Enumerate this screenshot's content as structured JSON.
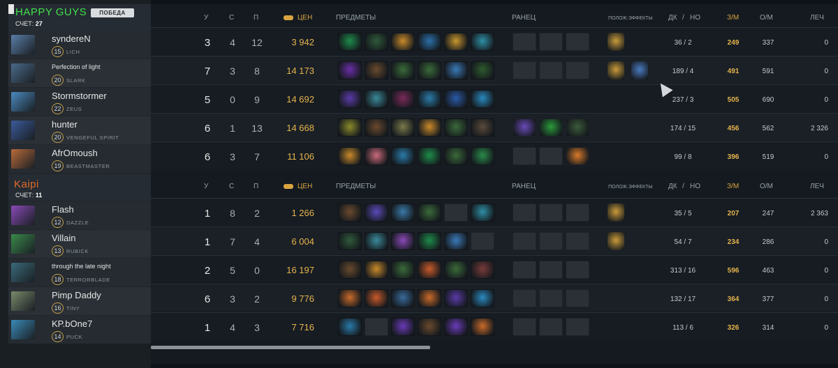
{
  "team1": {
    "name": "HAPPY GUYS",
    "badge": "ПОБЕДА",
    "score_label": "СЧЕТ:",
    "score": "27",
    "name_color": "#3fe04a",
    "players": [
      {
        "name": "syndereN",
        "level": "15",
        "hero": "LICH",
        "portrait": "#5a7fa8",
        "k": "3",
        "d": "4",
        "a": "12",
        "nw": "3 942",
        "items": [
          "#1e8b4a",
          "#2f5a3a",
          "#c98b2a",
          "#2a6fa8",
          "#c9962e",
          "#2e8fa5"
        ],
        "bag": [
          "e",
          "e",
          "e"
        ],
        "buffs": [
          "#c99a3a"
        ],
        "lhd": "36 / 2",
        "gpm": "249",
        "xpm": "337",
        "heal": "0"
      },
      {
        "name": "Perfection of light",
        "level": "20",
        "hero": "SLARK",
        "portrait": "#4a6a8a",
        "k": "7",
        "d": "3",
        "a": "8",
        "nw": "14 173",
        "items": [
          "#6a2ea8",
          "#6a4a2e",
          "#3a6a3a",
          "#3a6a3a",
          "#3a7ab8",
          "#2e5a2e"
        ],
        "bag": [
          "e",
          "e",
          "e"
        ],
        "buffs": [
          "#c99a3a",
          "#4a7ac0"
        ],
        "lhd": "189 / 4",
        "gpm": "491",
        "xpm": "591",
        "heal": "0"
      },
      {
        "name": "Stormstormer",
        "level": "22",
        "hero": "ZEUS",
        "portrait": "#4a8ac0",
        "k": "5",
        "d": "0",
        "a": "9",
        "nw": "14 692",
        "items": [
          "#5a3aa8",
          "#3a8a9a",
          "#7a2a5a",
          "#2a7aa8",
          "#2a5aa8",
          "#2a8ac0"
        ],
        "bag": [],
        "buffs": [],
        "lhd": "237 / 3",
        "gpm": "505",
        "xpm": "690",
        "heal": "0"
      },
      {
        "name": "hunter",
        "level": "20",
        "hero": "VENGEFUL SPIRIT",
        "portrait": "#3a5a9a",
        "k": "6",
        "d": "1",
        "a": "13",
        "nw": "14 668",
        "items": [
          "#8a8a2a",
          "#6a4a2e",
          "#7a7a4a",
          "#c98a2a",
          "#3a6a3a",
          "#5a4a3a"
        ],
        "bag": [
          "#6a4ab8",
          "#2a9a3a",
          "#3a5a3a"
        ],
        "buffs": [],
        "lhd": "174 / 15",
        "gpm": "456",
        "xpm": "562",
        "heal": "2 326"
      },
      {
        "name": "AfrOmoush",
        "level": "19",
        "hero": "BEASTMASTER",
        "portrait": "#b86a3a",
        "k": "6",
        "d": "3",
        "a": "7",
        "nw": "11 106",
        "items": [
          "#c98a2a",
          "#c96a7a",
          "#2a7aa8",
          "#1e8b4a",
          "#3a6a3a",
          "#2a8a4a"
        ],
        "bag": [
          "e",
          "e",
          "#d97a2a"
        ],
        "buffs": [],
        "lhd": "99 / 8",
        "gpm": "396",
        "xpm": "519",
        "heal": "0"
      }
    ]
  },
  "team2": {
    "name": "Kaipi",
    "score_label": "СЧЕТ:",
    "score": "11",
    "name_color": "#e36a2a",
    "players": [
      {
        "name": "Flash",
        "level": "12",
        "hero": "DAZZLE",
        "portrait": "#8a4ab8",
        "k": "1",
        "d": "8",
        "a": "2",
        "nw": "1 266",
        "items": [
          "#6a4a2e",
          "#5a4ab8",
          "#3a7aa8",
          "#3a6a3a",
          "e",
          "#2e8fa5"
        ],
        "bag": [
          "e",
          "e",
          "e"
        ],
        "buffs": [
          "#c99a3a"
        ],
        "lhd": "35 / 5",
        "gpm": "207",
        "xpm": "247",
        "heal": "2 363"
      },
      {
        "name": "Villain",
        "level": "13",
        "hero": "RUBICK",
        "portrait": "#3a8a4a",
        "k": "1",
        "d": "7",
        "a": "4",
        "nw": "6 004",
        "items": [
          "#2f5a3a",
          "#3a8a9a",
          "#8a4ab8",
          "#1e8b4a",
          "#3a7ab8",
          "e"
        ],
        "bag": [
          "e",
          "e",
          "e"
        ],
        "buffs": [
          "#c99a3a"
        ],
        "lhd": "54 / 7",
        "gpm": "234",
        "xpm": "286",
        "heal": "0"
      },
      {
        "name": "through the late night",
        "level": "18",
        "hero": "TERRORBLADE",
        "portrait": "#3a6a7a",
        "k": "2",
        "d": "5",
        "a": "0",
        "nw": "16 197",
        "items": [
          "#6a4a2e",
          "#c98a2a",
          "#3a6a3a",
          "#c95a2a",
          "#3a6a3a",
          "#7a3a3a"
        ],
        "bag": [
          "e",
          "e",
          "e"
        ],
        "buffs": [],
        "lhd": "313 / 16",
        "gpm": "596",
        "xpm": "463",
        "heal": "0"
      },
      {
        "name": "Pimp Daddy",
        "level": "16",
        "hero": "TINY",
        "portrait": "#7a8a6a",
        "k": "6",
        "d": "3",
        "a": "2",
        "nw": "9 776",
        "items": [
          "#c96a2a",
          "#c95a2a",
          "#3a6a9a",
          "#c96a2a",
          "#5a3aa8",
          "#2a8ac0"
        ],
        "bag": [
          "e",
          "e",
          "e"
        ],
        "buffs": [],
        "lhd": "132 / 17",
        "gpm": "364",
        "xpm": "377",
        "heal": "0"
      },
      {
        "name": "KP.bOne7",
        "level": "14",
        "hero": "PUCK",
        "portrait": "#3a8ab8",
        "k": "1",
        "d": "4",
        "a": "3",
        "nw": "7 716",
        "items": [
          "#2a7aa8",
          "e",
          "#6a3ab8",
          "#6a4a2e",
          "#6a3ab8",
          "#c96a2a"
        ],
        "bag": [
          "e",
          "e",
          "e"
        ],
        "buffs": [],
        "lhd": "113 / 6",
        "gpm": "326",
        "xpm": "314",
        "heal": "0"
      }
    ]
  },
  "headers": {
    "kills": "У",
    "deaths": "С",
    "assists": "П",
    "networth": "ЦЕН",
    "items": "ПРЕДМЕТЫ",
    "backpack": "РАНЕЦ",
    "buffs": "ПОЛОЖ.ЭФФЕКТЫ",
    "lh": "ДК",
    "slash": "/",
    "dn": "НО",
    "gpm": "З/М",
    "xpm": "О/М",
    "heal": "ЛЕЧ"
  }
}
